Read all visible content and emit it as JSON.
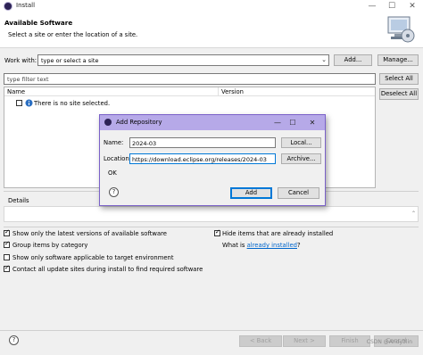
{
  "window": {
    "title": "Install"
  },
  "header": {
    "title": "Available Software",
    "subtitle": "Select a site or enter the location of a site."
  },
  "work_with": {
    "label": "Work with:",
    "placeholder": "type or select a site",
    "add_label": "Add...",
    "manage_label": "Manage..."
  },
  "filter": {
    "placeholder": "type filter text"
  },
  "side_buttons": {
    "select_all": "Select All",
    "deselect_all": "Deselect All"
  },
  "tree": {
    "columns": [
      "Name",
      "Version"
    ],
    "items": [
      {
        "label": "There is no site selected.",
        "checked": false
      }
    ]
  },
  "details": {
    "label": "Details"
  },
  "options": {
    "left": [
      {
        "label": "Show only the latest versions of available software",
        "checked": true
      },
      {
        "label": "Group items by category",
        "checked": true
      },
      {
        "label": "Show only software applicable to target environment",
        "checked": false
      },
      {
        "label": "Contact all update sites during install to find required software",
        "checked": true
      }
    ],
    "hide_installed": {
      "label": "Hide items that are already installed",
      "checked": true
    },
    "what_is_prefix": "What is ",
    "what_is_link": "already installed",
    "what_is_suffix": "?"
  },
  "footer": {
    "back": "< Back",
    "next": "Next >",
    "finish": "Finish",
    "cancel": "Cancel"
  },
  "dialog": {
    "title": "Add Repository",
    "name_label": "Name:",
    "name_value": "2024-03",
    "local_label": "Local...",
    "location_label": "Location:",
    "location_value": "https://download.eclipse.org/releases/2024-03",
    "archive_label": "Archive...",
    "status": "OK",
    "add_label": "Add",
    "cancel_label": "Cancel"
  },
  "watermark": "CSDN @Andy3lin",
  "colors": {
    "dialog_title": "#b6a9e8",
    "link": "#0066cc",
    "primary_border": "#0078d7"
  }
}
